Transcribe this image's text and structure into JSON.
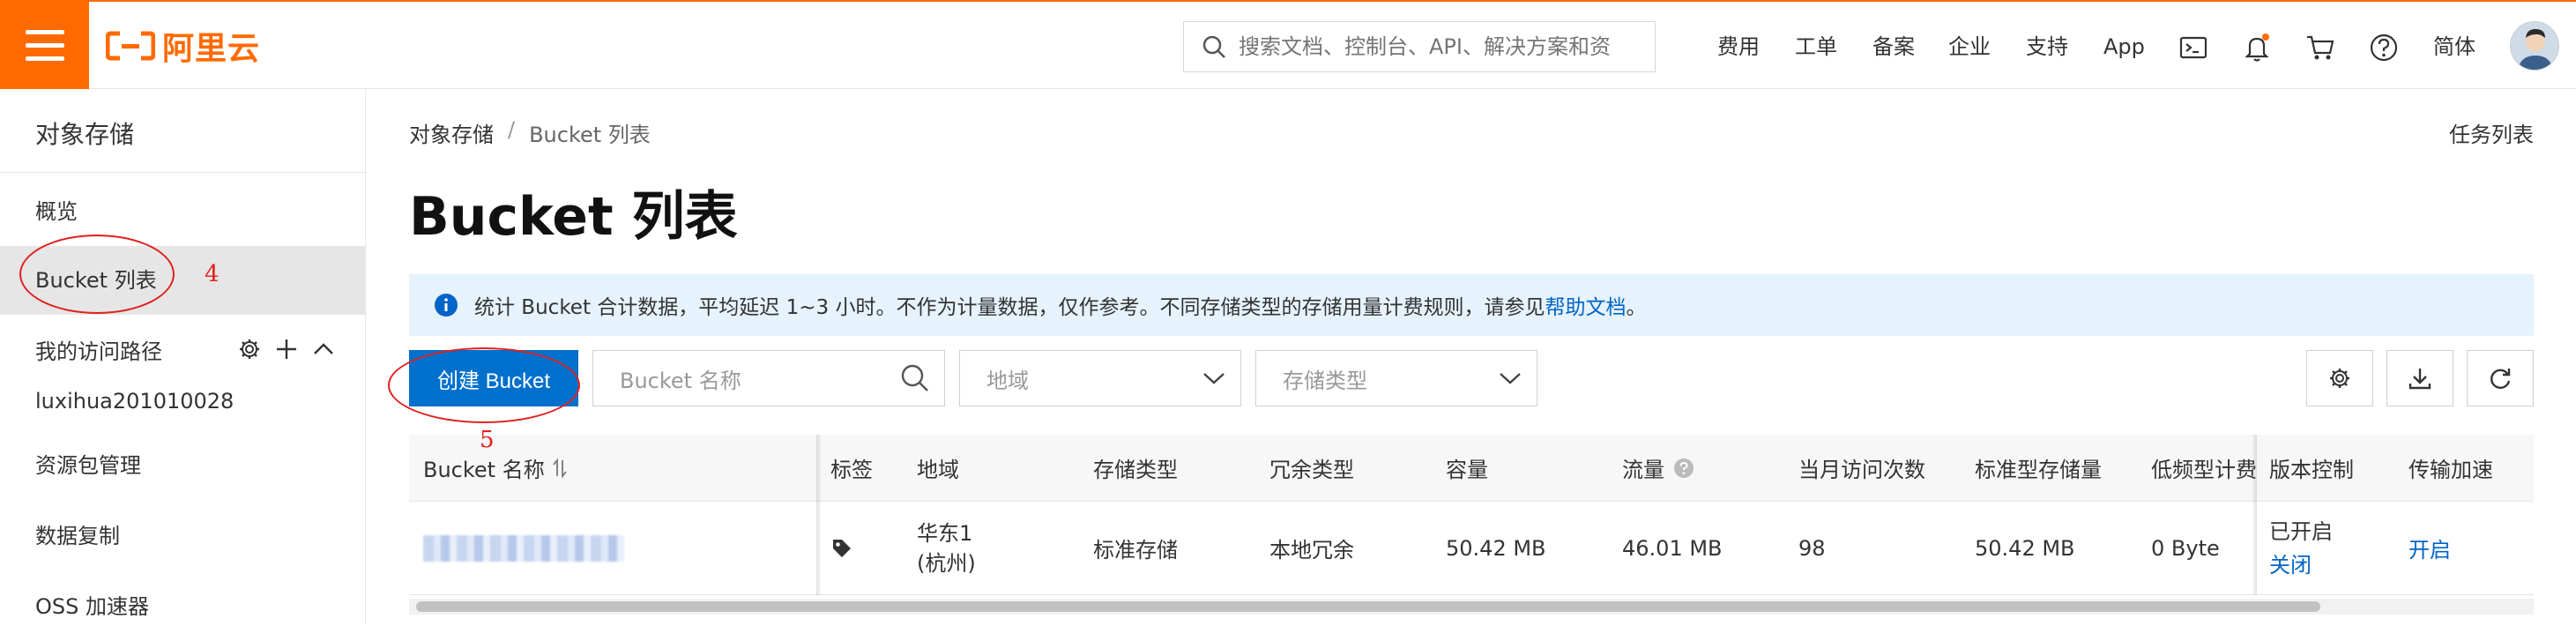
{
  "header": {
    "logo_text": "阿里云",
    "search_placeholder": "搜索文档、控制台、API、解决方案和资",
    "nav": [
      "费用",
      "工单",
      "备案",
      "企业",
      "支持",
      "App"
    ],
    "lang": "简体",
    "accent_color": "#ff6a00"
  },
  "sidebar": {
    "title": "对象存储",
    "items": [
      {
        "label": "概览"
      },
      {
        "label": "Bucket 列表"
      },
      {
        "label": "luxihua201010028"
      },
      {
        "label": "资源包管理"
      },
      {
        "label": "数据复制"
      },
      {
        "label": "OSS 加速器"
      }
    ],
    "group_label": "我的访问路径"
  },
  "breadcrumb": {
    "root": "对象存储",
    "sep": "/",
    "current": "Bucket 列表"
  },
  "task_list": "任务列表",
  "page_title": "Bucket 列表",
  "notice": {
    "text": "统计 Bucket 合计数据，平均延迟 1~3 小时。不作为计量数据，仅作参考。不同存储类型的存储用量计费规则，请参见",
    "link": "帮助文档",
    "suffix": "。"
  },
  "toolbar": {
    "create_button": "创建 Bucket",
    "name_placeholder": "Bucket 名称",
    "region_placeholder": "地域",
    "storage_placeholder": "存储类型"
  },
  "table": {
    "headers": [
      "Bucket 名称",
      "标签",
      "地域",
      "存储类型",
      "冗余类型",
      "容量",
      "流量",
      "当月访问次数",
      "标准型存储量",
      "低频型计费",
      "版本控制",
      "传输加速"
    ],
    "row": {
      "region_line1": "华东1",
      "region_line2": "(杭州)",
      "storage_type": "标准存储",
      "redundancy": "本地冗余",
      "capacity": "50.42 MB",
      "traffic": "46.01 MB",
      "visits": "98",
      "standard_storage": "50.42 MB",
      "ia_storage": "0 Byte",
      "versioning_status": "已开启",
      "versioning_action": "关闭",
      "transfer_accel_action": "开启"
    }
  },
  "annotations": {
    "sidebar_mark": "4",
    "button_mark": "5"
  },
  "colors": {
    "primary": "#0070cc",
    "link": "#0064c8",
    "annotation": "#e0201e",
    "notice_bg": "#e6f2fc"
  }
}
